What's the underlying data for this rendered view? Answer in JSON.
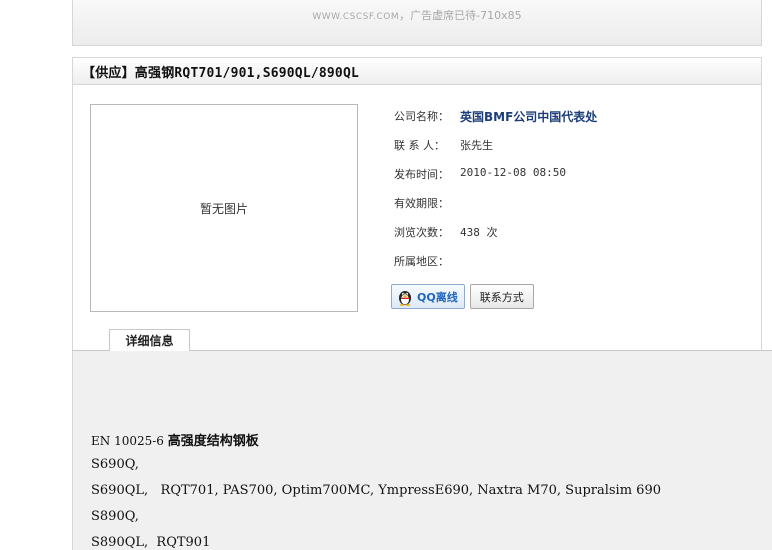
{
  "ad": {
    "site": "WWW.CSCSF.COM",
    "text": "，广告虚席已待-710x85"
  },
  "product": {
    "title": "【供应】高强钢RQT701/901,S690QL/890QL"
  },
  "image": {
    "placeholder": "暂无图片"
  },
  "fields": {
    "company_label": "公司名称：",
    "company_value": "英国BMF公司中国代表处",
    "contact_label": "联 系 人：",
    "contact_value": "张先生",
    "date_label": "发布时间：",
    "date_value": "2010-12-08 08:50",
    "validity_label": "有效期限：",
    "validity_value": "",
    "views_label": "浏览次数：",
    "views_value": "438 次",
    "region_label": "所属地区：",
    "region_value": ""
  },
  "buttons": {
    "qq_label": "QQ离线",
    "contact_label": "联系方式"
  },
  "tabs": {
    "detail_label": "详细信息"
  },
  "detail": {
    "line1_prefix": "EN 10025-6 ",
    "line1_bold": "高强度结构钢板",
    "line2": "S690Q,",
    "line3": "S690QL,   RQT701, PAS700, Optim700MC, YmpressE690, Naxtra M70, Supralsim 690",
    "line4": "S890Q,",
    "line5": "S890QL,  RQT901"
  },
  "colors": {
    "company_text": "#1d3e7a",
    "qq_text": "#2266bb",
    "detail_background": "#f0f0f0"
  },
  "icons": {
    "qq": "qq-penguin-icon"
  }
}
